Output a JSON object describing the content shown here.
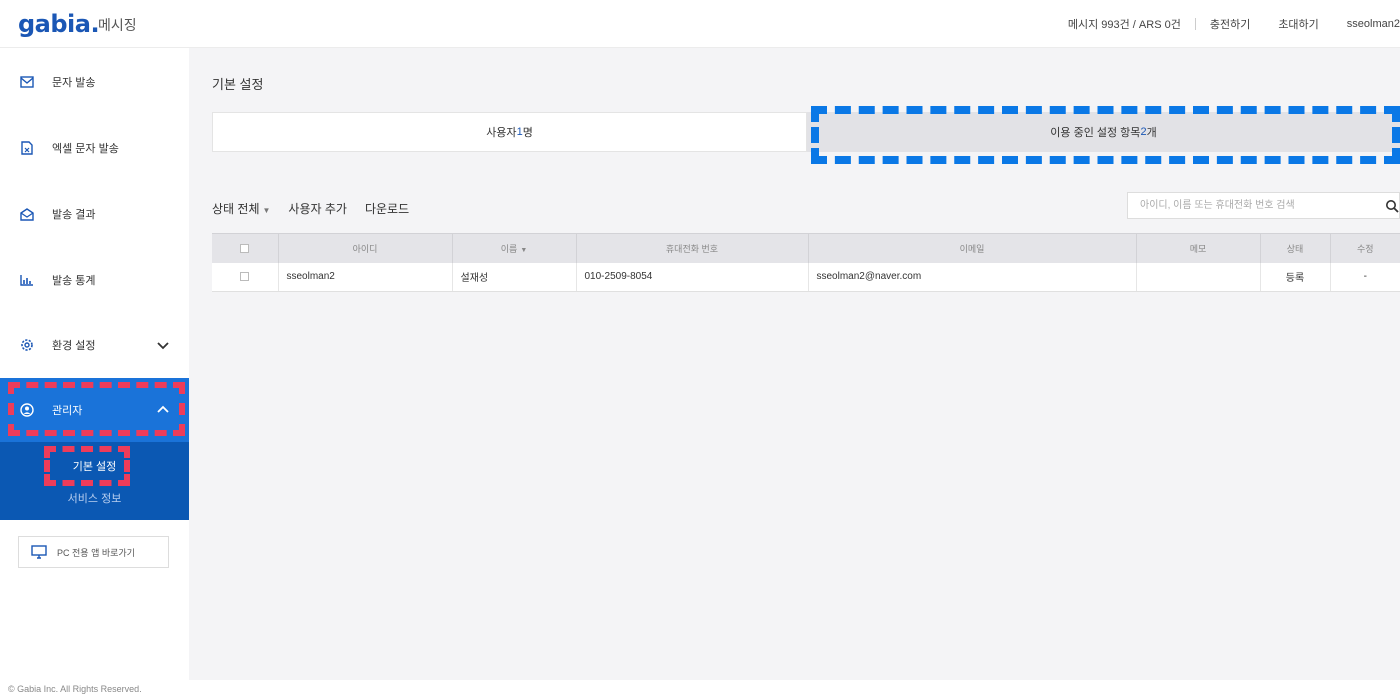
{
  "header": {
    "logo": "gabia.",
    "logo_sub": "메시징",
    "balance": "메시지 993건 / ARS 0건",
    "charge": "충전하기",
    "invite": "초대하기",
    "user": "sseolman2"
  },
  "sidebar": {
    "items": [
      {
        "label": "문자 발송",
        "icon": "mail-icon"
      },
      {
        "label": "엑셀 문자 발송",
        "icon": "excel-file-icon"
      },
      {
        "label": "발송 결과",
        "icon": "inbox-icon"
      },
      {
        "label": "발송 통계",
        "icon": "bar-chart-icon"
      },
      {
        "label": "환경 설정",
        "icon": "gear-icon"
      },
      {
        "label": "관리자",
        "icon": "user-circle-icon"
      }
    ],
    "admin_sub": [
      "기본 설정",
      "서비스 정보"
    ],
    "pc_button": "PC 전용 앱 바로가기"
  },
  "main": {
    "title": "기본 설정",
    "tab_users_prefix": "사용자 ",
    "tab_users_count": "1",
    "tab_users_suffix": "명",
    "tab_settings_prefix": "이용 중인 설정 항목 ",
    "tab_settings_count": "2",
    "tab_settings_suffix": "개",
    "toolbar": {
      "status": "상태 전체",
      "add_user": "사용자 추가",
      "download": "다운로드"
    },
    "search_placeholder": "아이디, 이름 또는 휴대전화 번호 검색"
  },
  "table": {
    "columns": [
      "아이디",
      "이름",
      "휴대전화 번호",
      "이메일",
      "메모",
      "상태",
      "수정"
    ],
    "rows": [
      {
        "id": "sseolman2",
        "name": "설재성",
        "phone": "010-2509-8054",
        "email": "sseolman2@naver.com",
        "memo": "",
        "status": "등록",
        "edit": "-"
      }
    ]
  },
  "footer": {
    "copyright": "© Gabia Inc. All Rights Reserved."
  },
  "colors": {
    "brand": "#1b57b5",
    "admin_active": "#1a73d9",
    "admin_sub": "#0b58b3",
    "highlight_red": "#ee3c5a",
    "highlight_blue": "#0a78e6"
  }
}
